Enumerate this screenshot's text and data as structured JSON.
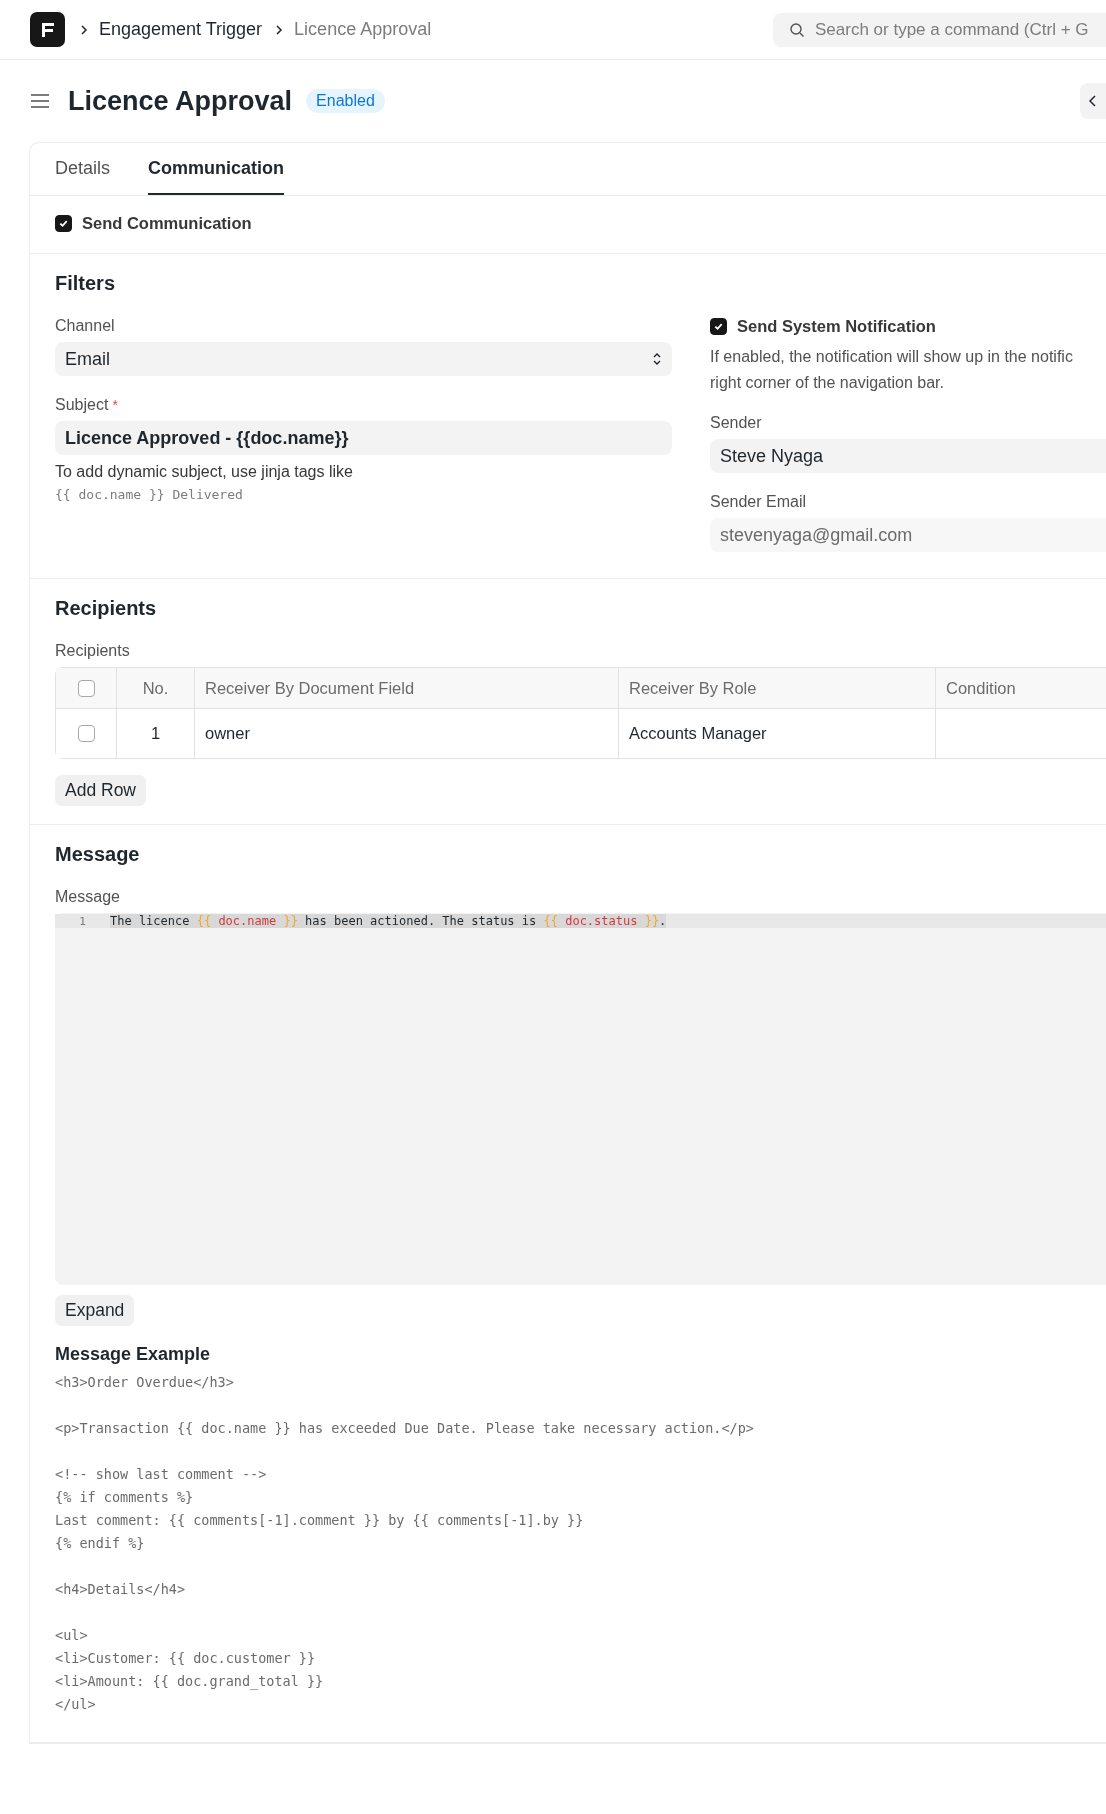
{
  "breadcrumbs": [
    {
      "label": "Engagement Trigger",
      "current": false
    },
    {
      "label": "Licence Approval",
      "current": true
    }
  ],
  "search": {
    "placeholder": "Search or type a command (Ctrl + G"
  },
  "page": {
    "title": "Licence Approval",
    "status": "Enabled"
  },
  "tabs": [
    {
      "label": "Details",
      "selected": false
    },
    {
      "label": "Communication",
      "selected": true
    }
  ],
  "send_communication": {
    "label": "Send Communication",
    "checked": true
  },
  "filters": {
    "heading": "Filters",
    "channel": {
      "label": "Channel",
      "value": "Email"
    },
    "subject": {
      "label": "Subject",
      "required_mark": "*",
      "value": "Licence Approved - {{doc.name}}",
      "hint": "To add dynamic subject, use jinja tags like",
      "hint_code": "{{ doc.name }} Delivered"
    },
    "system_notification": {
      "label": "Send System Notification",
      "checked": true,
      "description": "If enabled, the notification will show up in the notific\nright corner of the navigation bar."
    },
    "sender": {
      "label": "Sender",
      "value": "Steve Nyaga"
    },
    "sender_email": {
      "label": "Sender Email",
      "value": "stevenyaga@gmail.com",
      "disabled": true
    }
  },
  "recipients": {
    "heading": "Recipients",
    "label": "Recipients",
    "all_checked": false,
    "columns": [
      "No.",
      "Receiver By Document Field",
      "Receiver By Role",
      "Condition"
    ],
    "rows": [
      {
        "checked": false,
        "cells": [
          "1",
          "owner",
          "Accounts Manager",
          ""
        ]
      }
    ],
    "add_button": "Add Row"
  },
  "message": {
    "heading": "Message",
    "label": "Message",
    "line_number": "1",
    "code": [
      {
        "kind": "plain",
        "text": "The licence "
      },
      {
        "kind": "brace",
        "text": "{{"
      },
      {
        "kind": "var",
        "text": " doc.name "
      },
      {
        "kind": "brace",
        "text": "}}"
      },
      {
        "kind": "plain",
        "text": " has been actioned. The status is "
      },
      {
        "kind": "brace",
        "text": "{{"
      },
      {
        "kind": "var",
        "text": " doc.status "
      },
      {
        "kind": "brace",
        "text": "}}"
      },
      {
        "kind": "plain",
        "text": "."
      }
    ],
    "expand_button": "Expand",
    "example_heading": "Message Example",
    "example": "<h3>Order Overdue</h3>\n\n<p>Transaction {{ doc.name }} has exceeded Due Date. Please take necessary action.</p>\n\n<!-- show last comment -->\n{% if comments %}\nLast comment: {{ comments[-1].comment }} by {{ comments[-1].by }}\n{% endif %}\n\n<h4>Details</h4>\n\n<ul>\n<li>Customer: {{ doc.customer }}\n<li>Amount: {{ doc.grand_total }}\n</ul>"
  }
}
